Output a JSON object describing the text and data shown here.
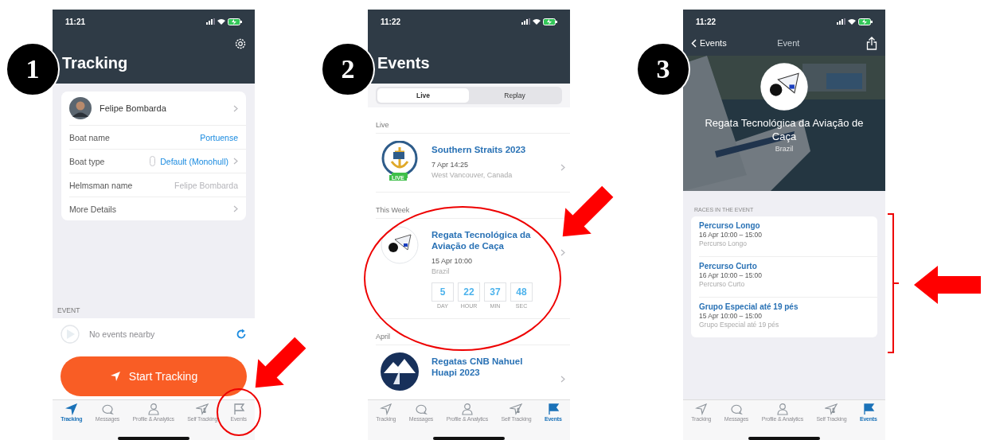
{
  "phones": [
    {
      "kind": "tracking",
      "number": "1",
      "status_time": "11:21",
      "title": "Tracking",
      "profile_name": "Felipe Bombarda",
      "fields": [
        {
          "label": "Boat name",
          "value": "Portuense",
          "kind": "link"
        },
        {
          "label": "Boat type",
          "value": "Default (Monohull)",
          "kind": "select"
        },
        {
          "label": "Helmsman name",
          "value": "Felipe Bombarda",
          "kind": "input"
        },
        {
          "label": "More Details",
          "kind": "nav"
        }
      ],
      "section_label": "EVENT",
      "nearby_text": "No events nearby",
      "start_button": "Start Tracking",
      "tabs": [
        {
          "label": "Tracking",
          "selected": true
        },
        {
          "label": "Messages",
          "selected": false
        },
        {
          "label": "Profile & Analytics",
          "selected": false
        },
        {
          "label": "Self Tracking",
          "selected": false
        },
        {
          "label": "Events",
          "selected": false
        }
      ]
    },
    {
      "kind": "events",
      "number": "2",
      "status_time": "11:22",
      "title": "Events",
      "segments": [
        {
          "label": "Live",
          "selected": true
        },
        {
          "label": "Replay",
          "selected": false
        }
      ],
      "sections": [
        {
          "header": "Live",
          "events": [
            {
              "name": "Southern Straits 2023",
              "date": "7 Apr 14:25",
              "place": "West Vancouver, Canada",
              "badge": "LIVE"
            }
          ]
        },
        {
          "header": "This Week",
          "events": [
            {
              "name": "Regata Tecnológica da Aviação de Caça",
              "date": "15 Apr 10:00",
              "place": "Brazil",
              "countdown": [
                {
                  "value": "5",
                  "unit": "DAY"
                },
                {
                  "value": "22",
                  "unit": "HOUR"
                },
                {
                  "value": "37",
                  "unit": "MIN"
                },
                {
                  "value": "48",
                  "unit": "SEC"
                }
              ]
            }
          ]
        },
        {
          "header": "April",
          "events": [
            {
              "name": "Regatas CNB Nahuel Huapi 2023"
            }
          ]
        }
      ],
      "tabs": [
        {
          "label": "Tracking",
          "selected": false
        },
        {
          "label": "Messages",
          "selected": false
        },
        {
          "label": "Profile & Analytics",
          "selected": false
        },
        {
          "label": "Self Tracking",
          "selected": false
        },
        {
          "label": "Events",
          "selected": true
        }
      ]
    },
    {
      "kind": "event_detail",
      "number": "3",
      "status_time": "11:22",
      "back_label": "Events",
      "nav_title": "Event",
      "event_name": "Regata Tecnológica da Aviação de Caça",
      "event_place": "Brazil",
      "races_label": "RACES IN THE EVENT",
      "races": [
        {
          "name": "Percurso Longo",
          "time": "16 Apr 10:00 – 15:00",
          "subtitle": "Percurso Longo"
        },
        {
          "name": "Percurso Curto",
          "time": "16 Apr 10:00 – 15:00",
          "subtitle": "Percurso Curto"
        },
        {
          "name": "Grupo Especial até 19 pés",
          "time": "15 Apr 10:00 – 15:00",
          "subtitle": "Grupo Especial até 19 pés"
        }
      ],
      "tabs": [
        {
          "label": "Tracking",
          "selected": false
        },
        {
          "label": "Messages",
          "selected": false
        },
        {
          "label": "Profile & Analytics",
          "selected": false
        },
        {
          "label": "Self Tracking",
          "selected": false
        },
        {
          "label": "Events",
          "selected": true
        }
      ]
    }
  ]
}
